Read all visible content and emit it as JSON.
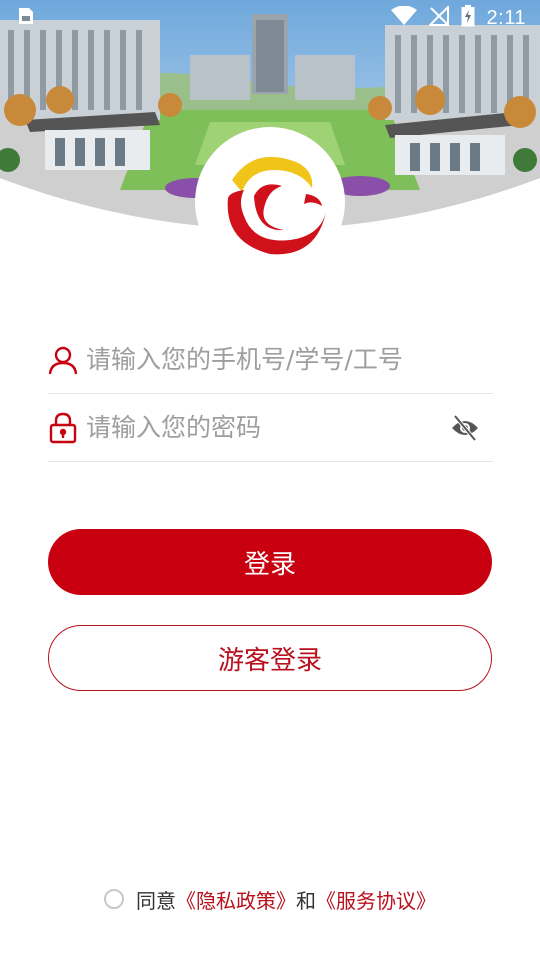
{
  "status_bar": {
    "time": "2:11",
    "icons": [
      "sim-card-icon",
      "wifi-icon",
      "no-signal-icon",
      "battery-charging-icon"
    ]
  },
  "header": {
    "photo": "campus-building-photo",
    "logo": "university-logo"
  },
  "form": {
    "phone_placeholder": "请输入您的手机号/学号/工号",
    "phone_value": "",
    "password_placeholder": "请输入您的密码",
    "password_value": "",
    "phone_icon": "user-icon",
    "password_icon": "lock-icon",
    "toggle_icon": "eye-off-icon"
  },
  "buttons": {
    "login_label": "登录",
    "guest_login_label": "游客登录"
  },
  "agreement": {
    "prefix": "同意",
    "privacy_link": "《隐私政策》",
    "joiner": "和",
    "service_link": "《服务协议》"
  },
  "colors": {
    "primary": "#c8000f",
    "accent_text": "#b8101c",
    "placeholder": "#9e9e9e"
  }
}
